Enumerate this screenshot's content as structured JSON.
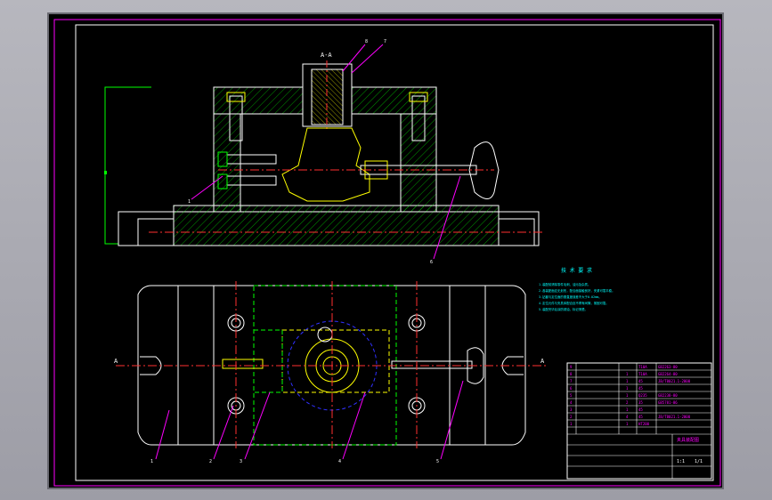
{
  "drawing": {
    "section_label": "A-A",
    "section_arrow_left": "A",
    "section_arrow_right": "A",
    "tech_title": "技 术 要 求",
    "tech_notes": [
      "1.装配前清除零件毛刺、油污及杂质。",
      "2.各装配面应无划伤，配合面接触良好，夹紧可靠平稳。",
      "3.钻套与定位面的垂直度误差不大于0.02mm。",
      "4.定位元件与夹具体配合处不得有间隙，紧固可靠。",
      "5.装配完毕后涂防锈油，标记清楚。"
    ],
    "balloons": [
      "1",
      "2",
      "3",
      "4",
      "5",
      "6",
      "7",
      "8"
    ],
    "title_block": {
      "rows": [
        [
          "9",
          "",
          "",
          "T10A",
          "GB2263-80"
        ],
        [
          "8",
          "",
          "1",
          "T10A",
          "GB2264-80"
        ],
        [
          "7",
          "",
          "1",
          "45",
          "JB/T8021.1-2000"
        ],
        [
          "6",
          "",
          "1",
          "45",
          ""
        ],
        [
          "5",
          "",
          "1",
          "Q235",
          "GB2238-80"
        ],
        [
          "4",
          "",
          "2",
          "35",
          "GB5781-86"
        ],
        [
          "3",
          "",
          "1",
          "45",
          ""
        ],
        [
          "2",
          "",
          "4",
          "45",
          "JB/T8021.1-2000"
        ],
        [
          "1",
          "",
          "1",
          "HT200",
          ""
        ]
      ],
      "drawing_name": "夹具装配图",
      "scale": "1:1",
      "sheet": "1/1"
    }
  }
}
